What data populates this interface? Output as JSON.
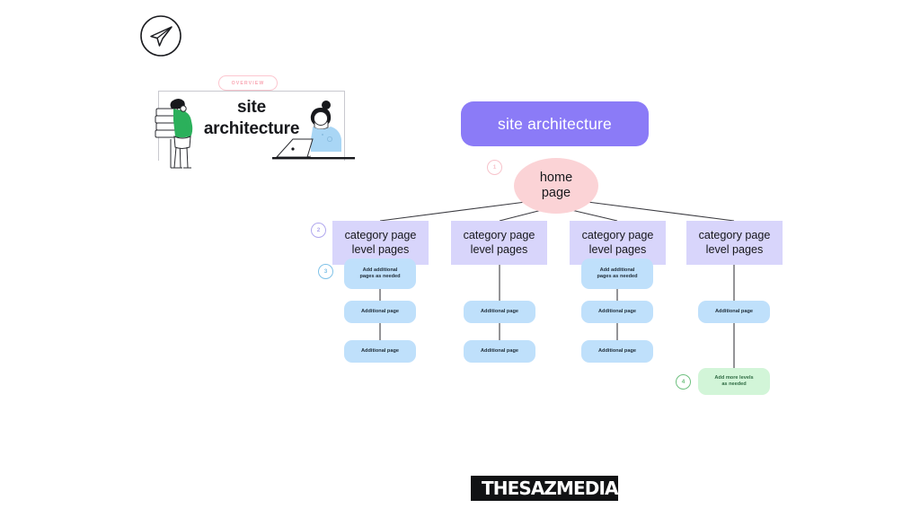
{
  "page": {
    "background_color": "#ffffff",
    "brand_icon": "paper-plane-icon"
  },
  "overview": {
    "badge_label": "OVERVIEW",
    "badge_color": "#f9a7b4",
    "board_title_line1": "site",
    "board_title_line2": "architecture",
    "illustration": "two-people-with-documents-and-laptop-illustration"
  },
  "header": {
    "title": "site architecture",
    "title_bg_color": "#8b7bf7",
    "title_text_color": "#ffffff"
  },
  "diagram": {
    "root": {
      "label_line1": "home",
      "label_line2": "page",
      "color": "#fbd3d6",
      "marker": "1"
    },
    "columns": [
      {
        "category_line1": "category page",
        "category_line2": "level pages",
        "category_marker": "2",
        "children": [
          {
            "type": "add",
            "line1": "Add additional",
            "line2": "pages as needed",
            "marker": "3",
            "color": "#bfe0fb"
          },
          {
            "type": "page",
            "line1": "Additional page",
            "line2": "",
            "color": "#bfe0fb"
          },
          {
            "type": "page",
            "line1": "Additional page",
            "line2": "",
            "color": "#bfe0fb"
          }
        ]
      },
      {
        "category_line1": "category page",
        "category_line2": "level pages",
        "category_marker": "",
        "children": [
          {
            "type": "page",
            "line1": "Additional page",
            "line2": "",
            "color": "#bfe0fb"
          },
          {
            "type": "page",
            "line1": "Additional page",
            "line2": "",
            "color": "#bfe0fb"
          }
        ]
      },
      {
        "category_line1": "category page",
        "category_line2": "level pages",
        "category_marker": "",
        "children": [
          {
            "type": "add",
            "line1": "Add additional",
            "line2": "pages as needed",
            "color": "#bfe0fb"
          },
          {
            "type": "page",
            "line1": "Additional page",
            "line2": "",
            "color": "#bfe0fb"
          },
          {
            "type": "page",
            "line1": "Additional page",
            "line2": "",
            "color": "#bfe0fb"
          }
        ]
      },
      {
        "category_line1": "category page",
        "category_line2": "level pages",
        "category_marker": "",
        "children": [
          {
            "type": "page",
            "line1": "Additional page",
            "line2": "",
            "color": "#bfe0fb"
          },
          {
            "type": "levels",
            "line1": "Add more levels",
            "line2": "as needed",
            "marker": "4",
            "color": "#d2f5d8"
          }
        ]
      }
    ],
    "category_box_color": "#d8d5fb",
    "connector_color": "#3c3c42"
  },
  "footer": {
    "logo_text": "THESAZMEDIA",
    "logo_icon": "paper-plane-icon",
    "logo_bg_color": "#111214"
  }
}
